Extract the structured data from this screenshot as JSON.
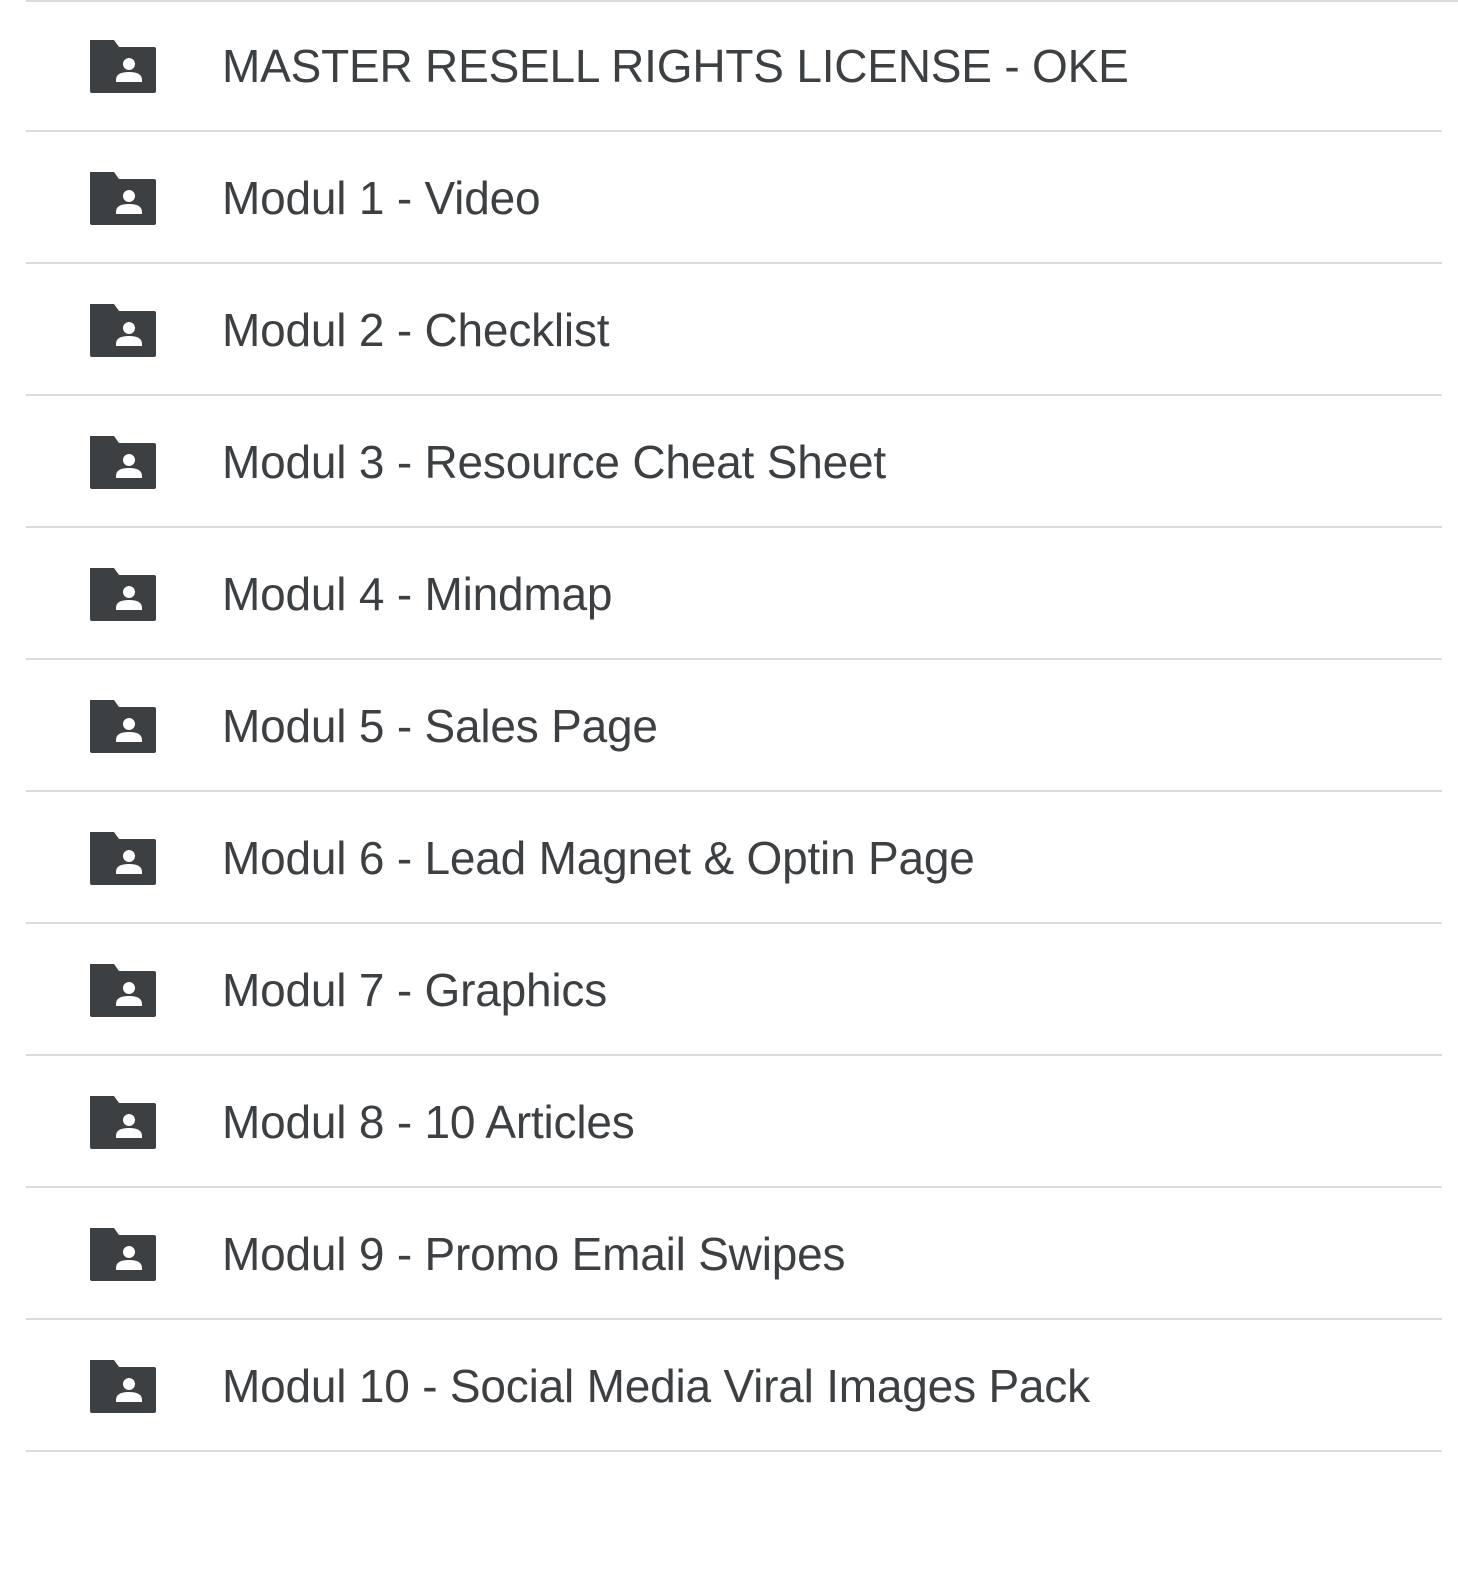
{
  "colors": {
    "text": "#3c4043",
    "icon": "#3c4043",
    "divider": "#dadce0",
    "background": "#ffffff"
  },
  "file_list": {
    "items": [
      {
        "name": "MASTER RESELL RIGHTS LICENSE - OKE",
        "icon": "shared-folder-icon"
      },
      {
        "name": "Modul 1 - Video",
        "icon": "shared-folder-icon"
      },
      {
        "name": "Modul 2 - Checklist",
        "icon": "shared-folder-icon"
      },
      {
        "name": "Modul 3 - Resource Cheat Sheet",
        "icon": "shared-folder-icon"
      },
      {
        "name": "Modul 4 - Mindmap",
        "icon": "shared-folder-icon"
      },
      {
        "name": "Modul 5 - Sales Page",
        "icon": "shared-folder-icon"
      },
      {
        "name": "Modul 6 - Lead Magnet & Optin Page",
        "icon": "shared-folder-icon"
      },
      {
        "name": "Modul 7 - Graphics",
        "icon": "shared-folder-icon"
      },
      {
        "name": "Modul 8 - 10 Articles",
        "icon": "shared-folder-icon"
      },
      {
        "name": "Modul 9 - Promo Email Swipes",
        "icon": "shared-folder-icon"
      },
      {
        "name": "Modul 10 - Social Media Viral Images Pack",
        "icon": "shared-folder-icon"
      }
    ]
  }
}
